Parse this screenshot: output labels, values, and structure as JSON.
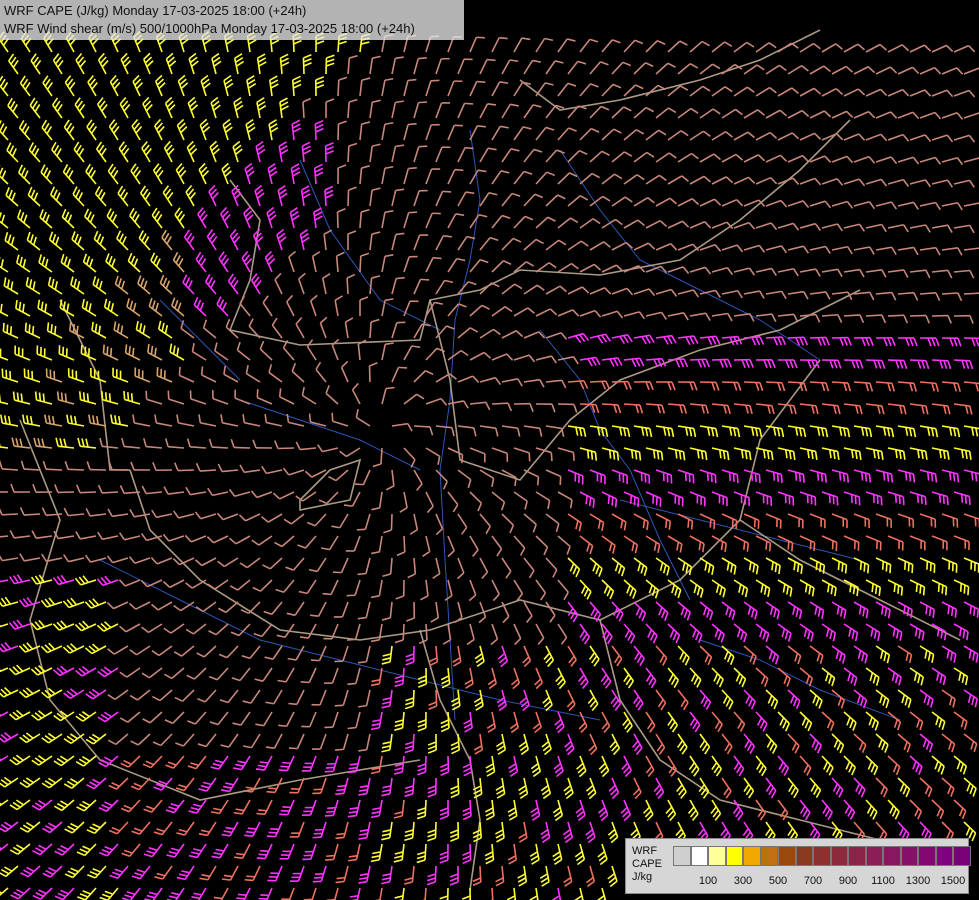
{
  "title": {
    "line1": "WRF CAPE (J/kg) Monday 17-03-2025 18:00 (+24h)",
    "line2": "WRF Wind shear (m/s) 500/1000hPa Monday 17-03-2025 18:00 (+24h)"
  },
  "legend": {
    "model": "WRF",
    "field": "CAPE",
    "unit": "J/kg",
    "colors": [
      "#cfcfcf",
      "#ffffff",
      "#ffff99",
      "#ffff00",
      "#f0a800",
      "#c07010",
      "#9a4a10",
      "#8a3a20",
      "#8c3030",
      "#8a2a3a",
      "#8a2448",
      "#8a1e55",
      "#881660",
      "#860f6a",
      "#840874",
      "#800080",
      "#7a0078"
    ],
    "ticks": [
      "100",
      "300",
      "500",
      "700",
      "900",
      "1100",
      "1300",
      "1500"
    ]
  },
  "wind_colors": {
    "low": "#c8877a",
    "mid": "#ef7060",
    "high": "#ffff33",
    "higher": "#ff33ff",
    "tan": "#d9a46b"
  },
  "borders_color": "#c9b59a",
  "rivers_color": "#2f55b5"
}
